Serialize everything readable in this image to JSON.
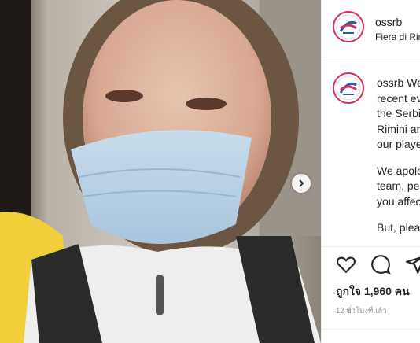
{
  "header": {
    "username": "ossrb",
    "location": "Fiera di Rim"
  },
  "caption": {
    "username": "ossrb",
    "lines": [
      "We",
      "recent ev",
      "the Serbi",
      "Rimini an",
      "our playe"
    ],
    "lines2": [
      "We apolo",
      "team, peo",
      "you affec"
    ],
    "lines3": [
      "But, pleas"
    ]
  },
  "actions": {
    "icons": [
      "heart-icon",
      "comment-icon",
      "share-icon"
    ]
  },
  "likes_text": "ถูกใจ 1,960 คน",
  "time_text": "12 ชั่วโมงที่แล้ว",
  "media": {
    "description_hidden": true
  },
  "colors": {
    "ring": "#d62f5a",
    "text": "#262626",
    "muted": "#8e8e8e"
  }
}
